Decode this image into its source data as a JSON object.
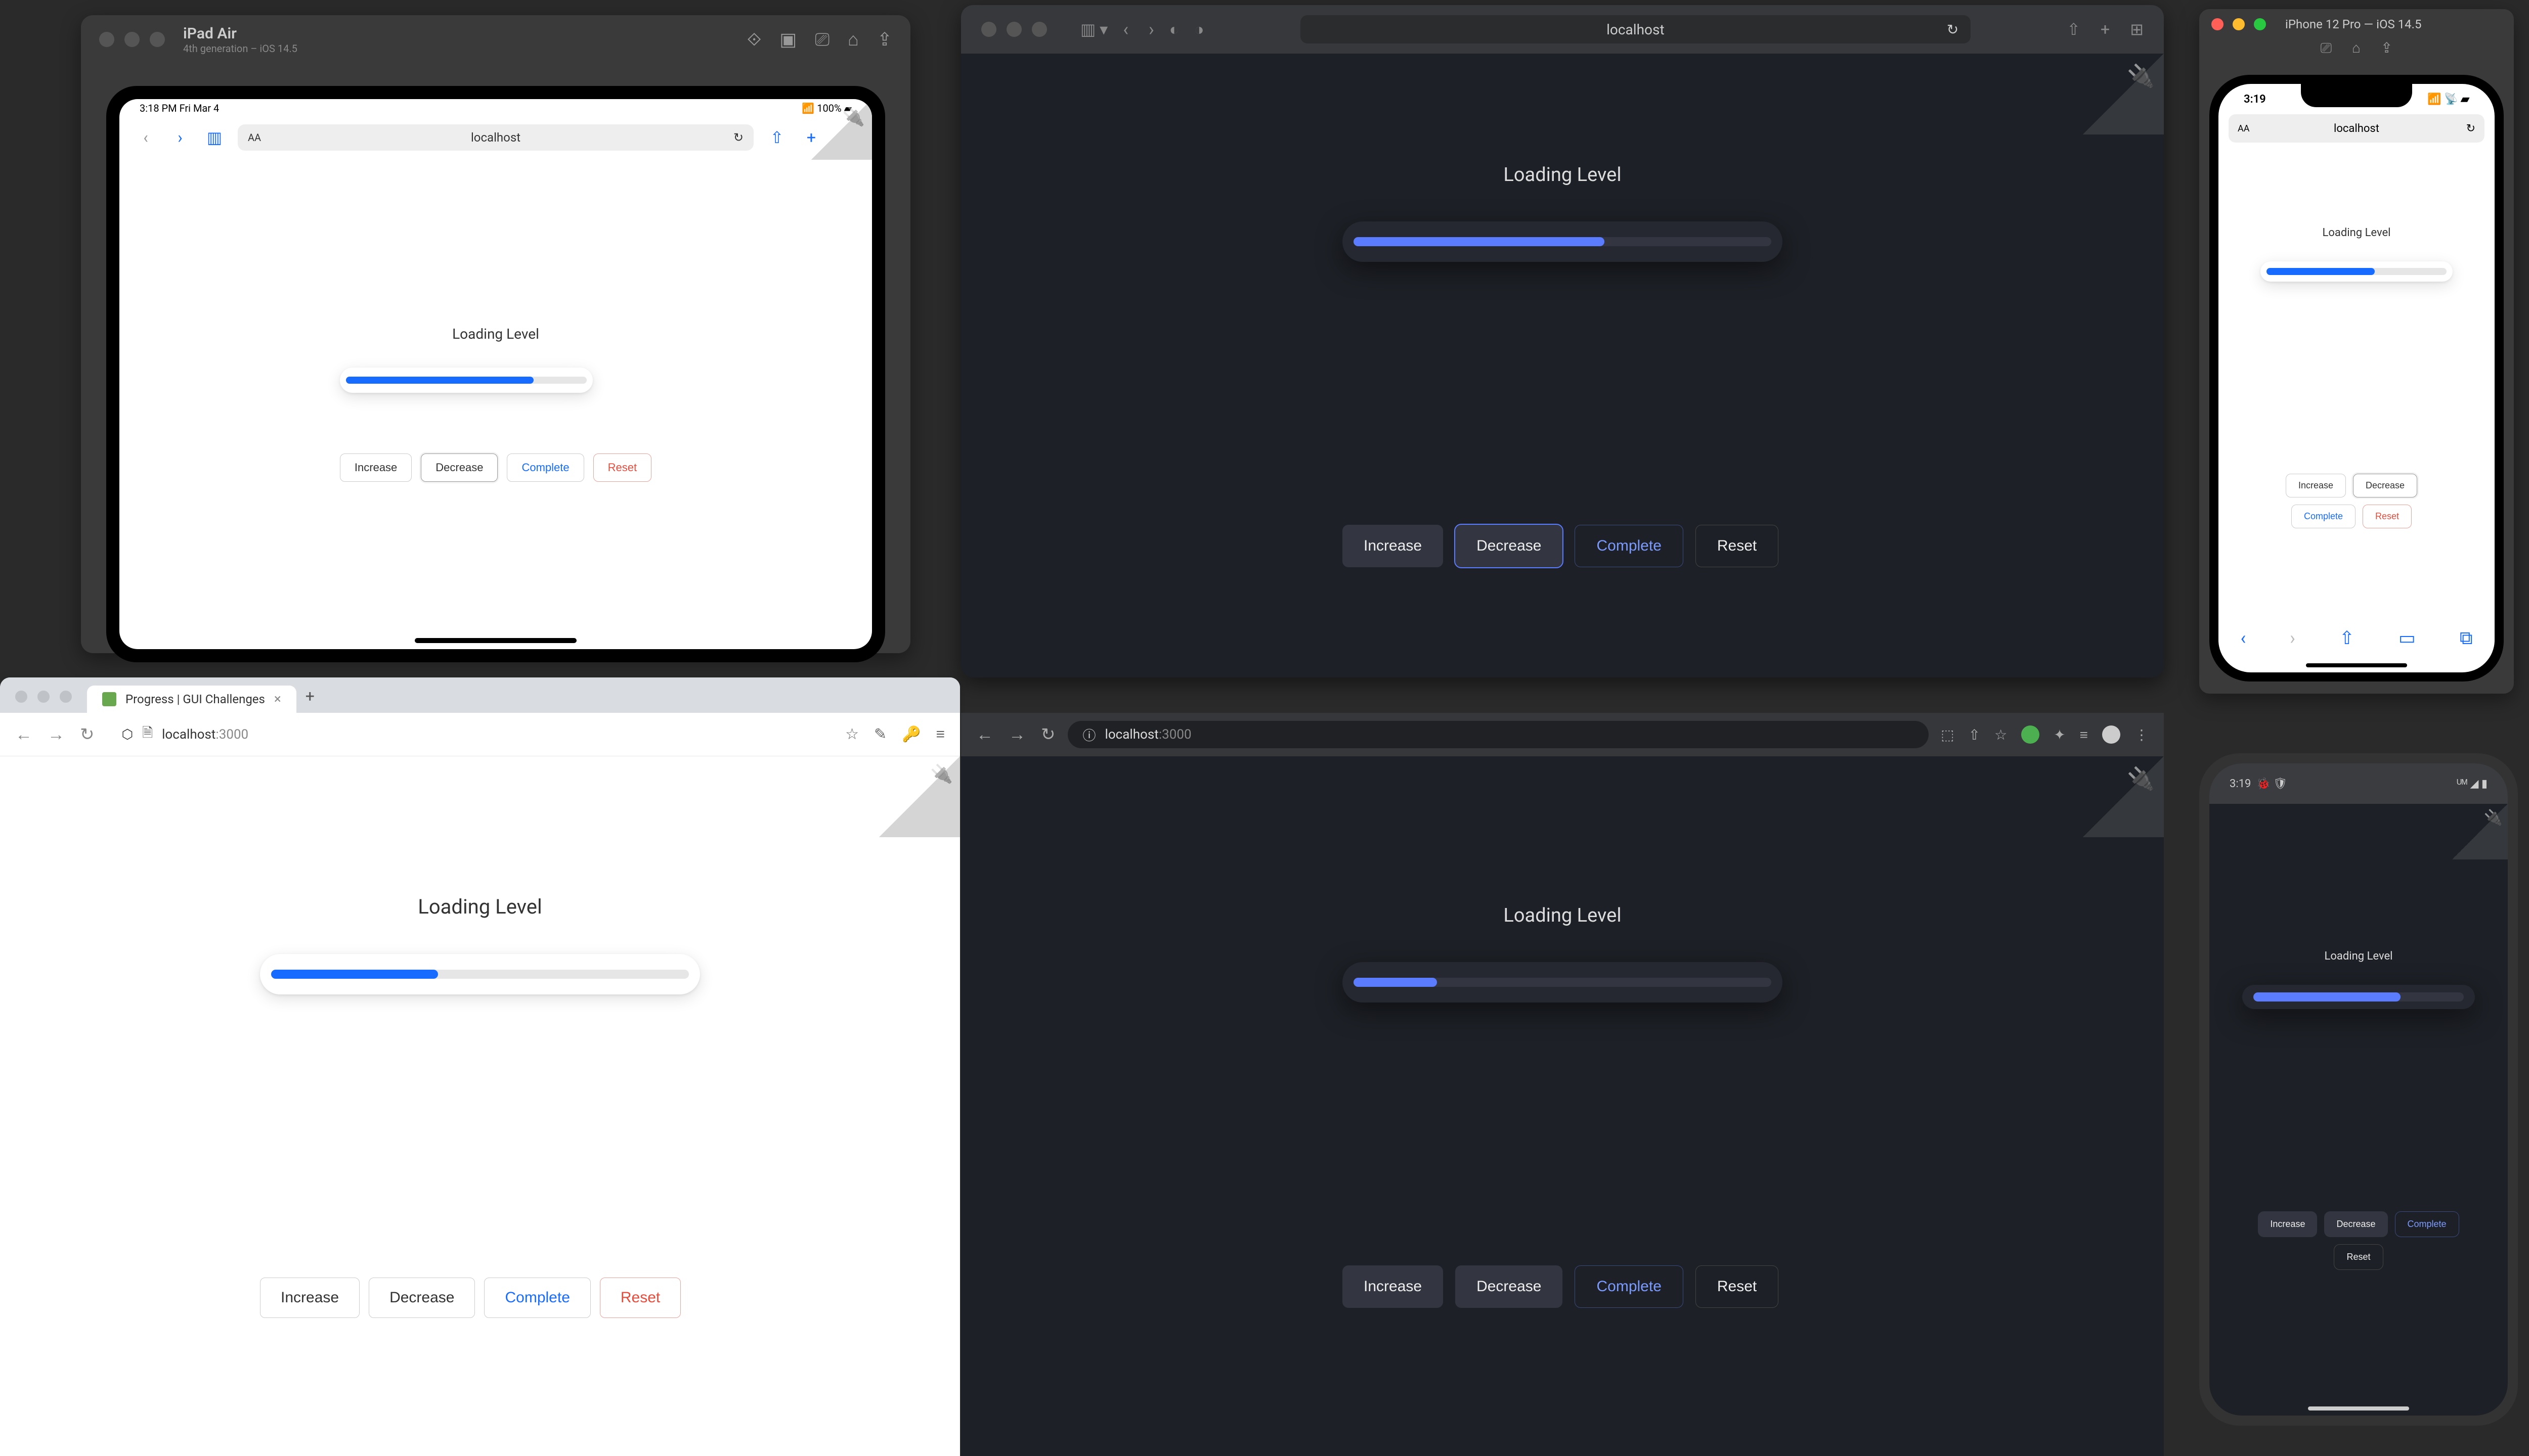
{
  "demo": {
    "label": "Loading Level",
    "buttons": {
      "increase": "Increase",
      "decrease": "Decrease",
      "complete": "Complete",
      "reset": "Reset"
    }
  },
  "ipad_sim": {
    "title": "iPad Air",
    "subtitle": "4th generation – iOS 14.5",
    "status_time": "3:18 PM  Fri Mar 4",
    "status_right": "📶 100% ▰",
    "url": "localhost",
    "progress_percent": 78
  },
  "safari_dark": {
    "url": "localhost",
    "progress_percent": 60
  },
  "iphone_sim": {
    "title": "iPhone 12 Pro — iOS 14.5",
    "status_time": "3:19",
    "url": "localhost",
    "progress_percent": 60
  },
  "chrome_light": {
    "tab_title": "Progress | GUI Challenges",
    "url_host": "localhost",
    "url_port": ":3000",
    "progress_percent": 40
  },
  "chrome_dark": {
    "url_host": "localhost",
    "url_port": ":3000",
    "progress_percent": 20
  },
  "android": {
    "status_time": "3:19",
    "status_debug": "🐞 🛡",
    "status_right": "ᵁᴹ ◢ ▮",
    "progress_percent": 70
  },
  "colors": {
    "accent_light": "#176cff",
    "accent_dark": "#5b7cff",
    "danger": "#e74c3c"
  }
}
